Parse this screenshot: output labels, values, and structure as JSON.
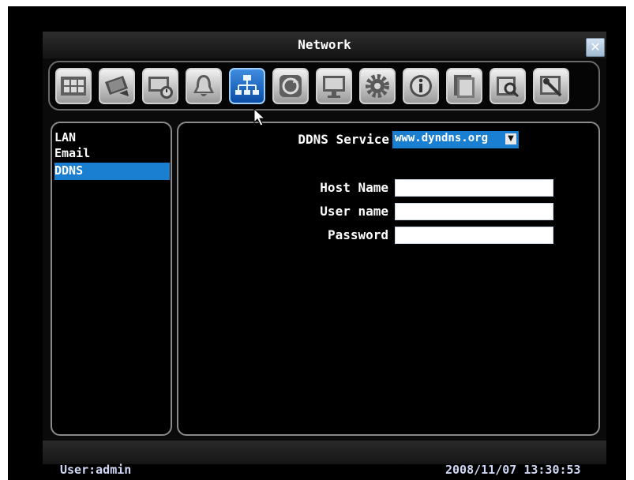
{
  "window": {
    "title": "Network"
  },
  "toolbar": {
    "items": [
      {
        "icon": "film-grid-icon"
      },
      {
        "icon": "camera-icon"
      },
      {
        "icon": "recording-timer-icon"
      },
      {
        "icon": "bell-icon"
      },
      {
        "icon": "network-icon"
      },
      {
        "icon": "circular-arrow-icon"
      },
      {
        "icon": "monitor-icon"
      },
      {
        "icon": "gear-icon"
      },
      {
        "icon": "info-icon"
      },
      {
        "icon": "folder-icon"
      },
      {
        "icon": "search-icon"
      },
      {
        "icon": "tools-icon"
      }
    ],
    "active_index": 4
  },
  "sidebar": {
    "items": [
      {
        "label": "LAN"
      },
      {
        "label": "Email"
      },
      {
        "label": "DDNS"
      }
    ],
    "selected": "DDNS"
  },
  "form": {
    "service_label": "DDNS Service",
    "service_value": "www.dyndns.org",
    "host_label": "Host Name",
    "host_value": "",
    "user_label": "User name",
    "user_value": "",
    "password_label": "Password",
    "password_value": ""
  },
  "status": {
    "user": "User:admin",
    "datetime": "2008/11/07  13:30:53"
  },
  "colors": {
    "accent": "#1a7fd1",
    "background": "#000000",
    "text": "#ffffff"
  }
}
